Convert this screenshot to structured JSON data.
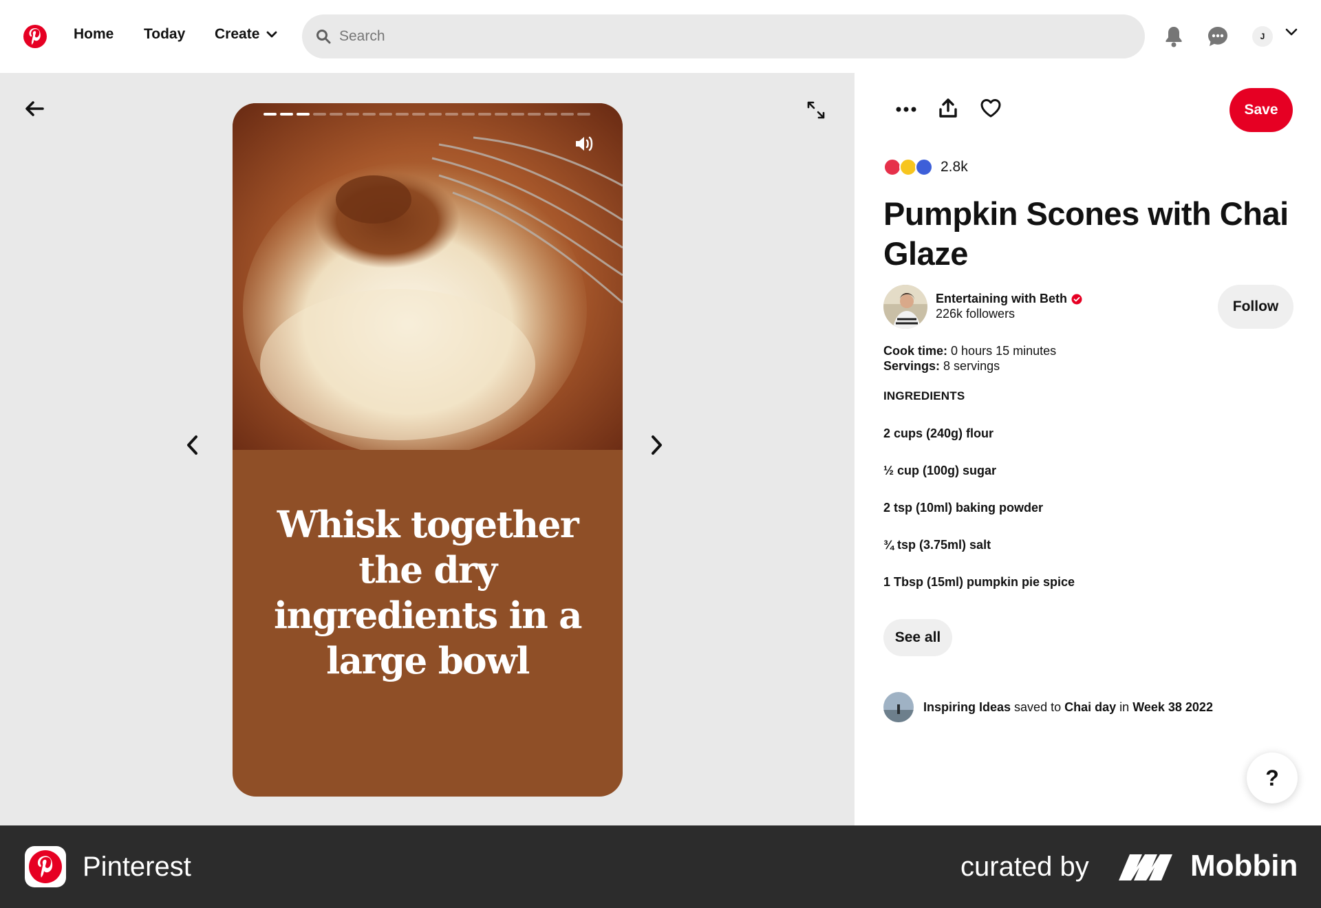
{
  "colors": {
    "brand": "#e60023",
    "story_bg": "#8f4f27",
    "pane_bg": "#e9e9e9",
    "footer_bg": "#2c2c2c"
  },
  "nav": {
    "home": "Home",
    "today": "Today",
    "create": "Create",
    "search_placeholder": "Search",
    "avatar_initial": "J",
    "icons": [
      "pinterest-logo-icon",
      "search-icon",
      "bell-icon",
      "chat-bubble-icon",
      "chevron-down-icon"
    ]
  },
  "story": {
    "caption": "Whisk together the dry ingredients in a large bowl",
    "progress_total": 20,
    "progress_done": 3
  },
  "detail": {
    "save_label": "Save",
    "reaction_count": "2.8k",
    "title": "Pumpkin Scones with Chai Glaze",
    "creator": {
      "name": "Entertaining with Beth",
      "followers": "226k followers"
    },
    "follow_label": "Follow",
    "cook_time_label": "Cook time:",
    "cook_time_value": "0 hours 15 minutes",
    "servings_label": "Servings:",
    "servings_value": "8 servings",
    "ingredients_heading": "INGREDIENTS",
    "ingredients": [
      "2 cups (240g) flour",
      "½ cup (100g) sugar",
      "2 tsp (10ml) baking powder",
      "¾ tsp (3.75ml) salt",
      "1 Tbsp (15ml) pumpkin pie spice"
    ],
    "see_all_label": "See all",
    "activity": {
      "user": "Inspiring Ideas",
      "verb1": "saved to",
      "board": "Chai day",
      "verb2": "in",
      "section": "Week 38 2022"
    },
    "help_label": "?"
  },
  "footer": {
    "app_name": "Pinterest",
    "curated_by": "curated by",
    "brand": "Mobbin"
  }
}
